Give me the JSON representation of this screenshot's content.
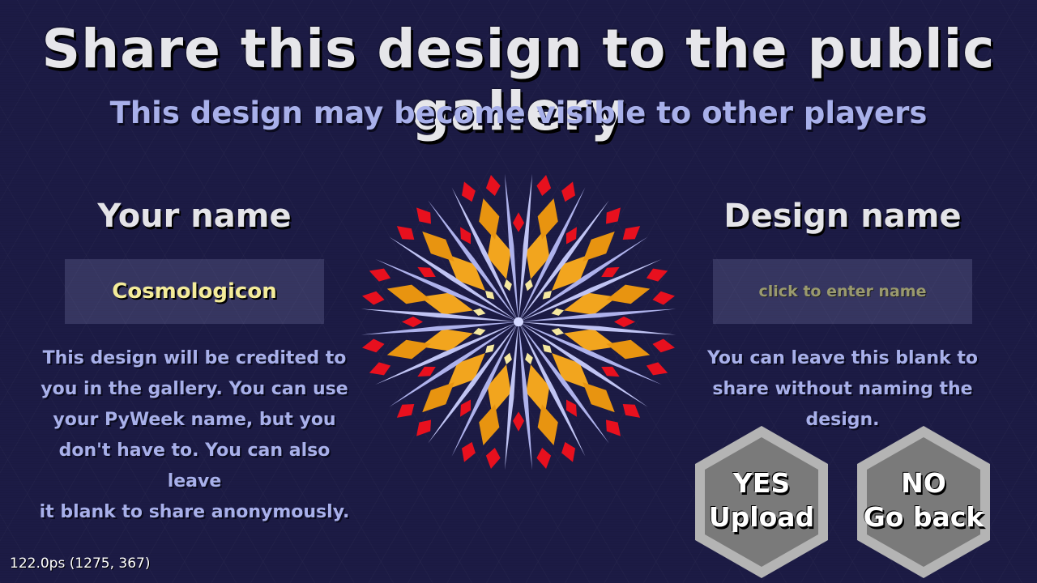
{
  "title": "Share this design to the public gallery",
  "subtitle": "This design may become visible to other players",
  "your_name": {
    "heading": "Your name",
    "value": "Cosmologicon",
    "description": [
      "This design will be credited to",
      "you in the gallery. You can use",
      "your PyWeek name, but you",
      "don't have to. You can also leave",
      "it blank to share anonymously."
    ]
  },
  "design_name": {
    "heading": "Design name",
    "placeholder": "click to enter name",
    "description": [
      "You can leave this blank to",
      "share without naming the",
      "design."
    ]
  },
  "buttons": {
    "yes": {
      "line1": "YES",
      "line2": "Upload"
    },
    "no": {
      "line1": "NO",
      "line2": "Go back"
    }
  },
  "fps_readout": "122.0ps (1275, 367)",
  "colors": {
    "background": "#1c1b45",
    "accent_text": "#a8b0ea",
    "name_text": "#f4ec9a",
    "button_fill": "#7a7a7a",
    "button_border": "#b4b4b4"
  }
}
